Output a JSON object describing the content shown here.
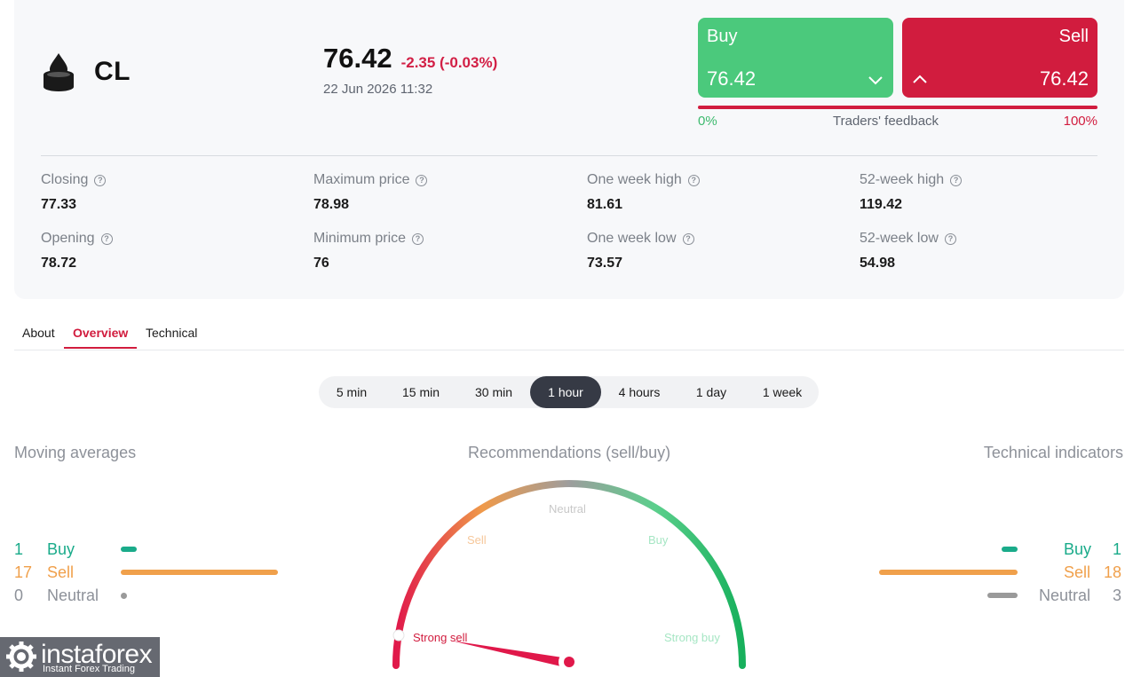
{
  "instrument": {
    "symbol": "CL",
    "price": "76.42",
    "change": "-2.35 (-0.03%)",
    "datetime": "22 Jun 2026 11:32"
  },
  "trade": {
    "buy_label": "Buy",
    "buy_price": "76.42",
    "sell_label": "Sell",
    "sell_price": "76.42"
  },
  "feedback": {
    "left_pct": "0%",
    "label": "Traders' feedback",
    "right_pct": "100%",
    "buy_share": 0.0
  },
  "stats": [
    {
      "label": "Closing",
      "value": "77.33"
    },
    {
      "label": "Maximum price",
      "value": "78.98"
    },
    {
      "label": "One week high",
      "value": "81.61"
    },
    {
      "label": "52-week high",
      "value": "119.42"
    },
    {
      "label": "Opening",
      "value": "78.72"
    },
    {
      "label": "Minimum price",
      "value": "76"
    },
    {
      "label": "One week low",
      "value": "73.57"
    },
    {
      "label": "52-week low",
      "value": "54.98"
    }
  ],
  "tabs": [
    {
      "label": "About",
      "active": false
    },
    {
      "label": "Overview",
      "active": true
    },
    {
      "label": "Technical",
      "active": false
    }
  ],
  "periods": [
    {
      "label": "5 min",
      "active": false
    },
    {
      "label": "15 min",
      "active": false
    },
    {
      "label": "30 min",
      "active": false
    },
    {
      "label": "1 hour",
      "active": true
    },
    {
      "label": "4 hours",
      "active": false
    },
    {
      "label": "1 day",
      "active": false
    },
    {
      "label": "1 week",
      "active": false
    }
  ],
  "moving_averages": {
    "title": "Moving averages",
    "buy": {
      "count": "1",
      "label": "Buy"
    },
    "sell": {
      "count": "17",
      "label": "Sell"
    },
    "neutral": {
      "count": "0",
      "label": "Neutral"
    }
  },
  "recommendations": {
    "title": "Recommendations (sell/buy)",
    "labels": {
      "strong_sell": "Strong sell",
      "sell": "Sell",
      "neutral": "Neutral",
      "buy": "Buy",
      "strong_buy": "Strong buy"
    },
    "reading": "Strong sell"
  },
  "technical_indicators": {
    "title": "Technical indicators",
    "buy": {
      "count": "1",
      "label": "Buy"
    },
    "sell": {
      "count": "18",
      "label": "Sell"
    },
    "neutral": {
      "count": "3",
      "label": "Neutral"
    }
  },
  "logo": {
    "name": "instaforex",
    "tagline": "Instant Forex Trading"
  },
  "colors": {
    "buy": "#4bc97c",
    "sell": "#d11c3e",
    "ma_buy": "#1aab8a",
    "ma_sell": "#f0a04b",
    "neutral": "#9a9a9a",
    "active_period": "#363a45"
  }
}
